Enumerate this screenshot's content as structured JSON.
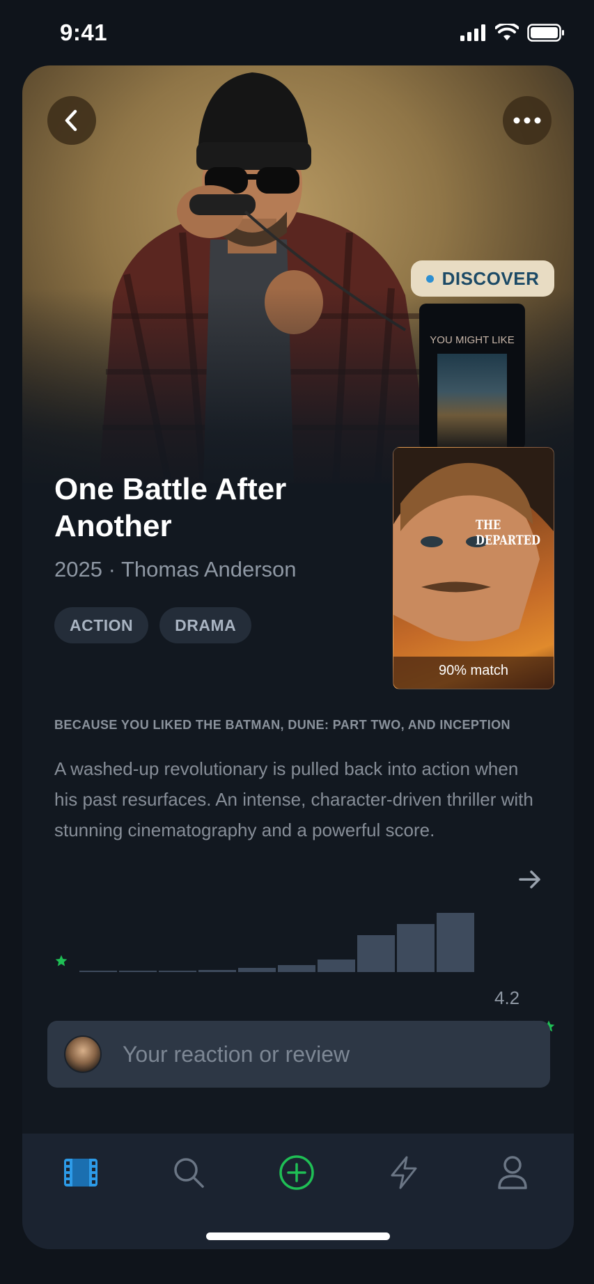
{
  "status_bar": {
    "time": "9:41"
  },
  "hero": {
    "discover_label": "DISCOVER",
    "you_might_like_label": "YOU MIGHT LIKE"
  },
  "recommendation": {
    "poster_title_line1": "THE",
    "poster_title_line2": "DEPARTED",
    "match_label": "90% match"
  },
  "movie": {
    "title": "One Battle After Another",
    "meta": "2025 · Thomas Anderson",
    "tags": [
      "ACTION",
      "DRAMA"
    ],
    "because_text": "BECAUSE YOU LIKED THE BATMAN, DUNE: PART TWO, AND INCEPTION",
    "description": "A washed-up revolutionary is pulled back into action when his past resurfaces. An intense, character-driven thriller with stunning cinematography and a powerful score."
  },
  "ratings": {
    "average": "4.2",
    "distribution": [
      0.02,
      0.02,
      0.02,
      0.03,
      0.06,
      0.11,
      0.2,
      0.58,
      0.75,
      0.92
    ],
    "colors": {
      "bar": "#3e4b5d",
      "star": "#1fbf55"
    }
  },
  "review": {
    "placeholder": "Your reaction or review"
  },
  "tabbar": {
    "items": [
      {
        "icon": "film-icon",
        "active": true
      },
      {
        "icon": "search-icon",
        "active": false
      },
      {
        "icon": "plus-circle-icon",
        "active": false
      },
      {
        "icon": "lightning-icon",
        "active": false
      },
      {
        "icon": "profile-icon",
        "active": false
      }
    ],
    "accent": "#2d9be8",
    "add_color": "#1fbf55"
  }
}
